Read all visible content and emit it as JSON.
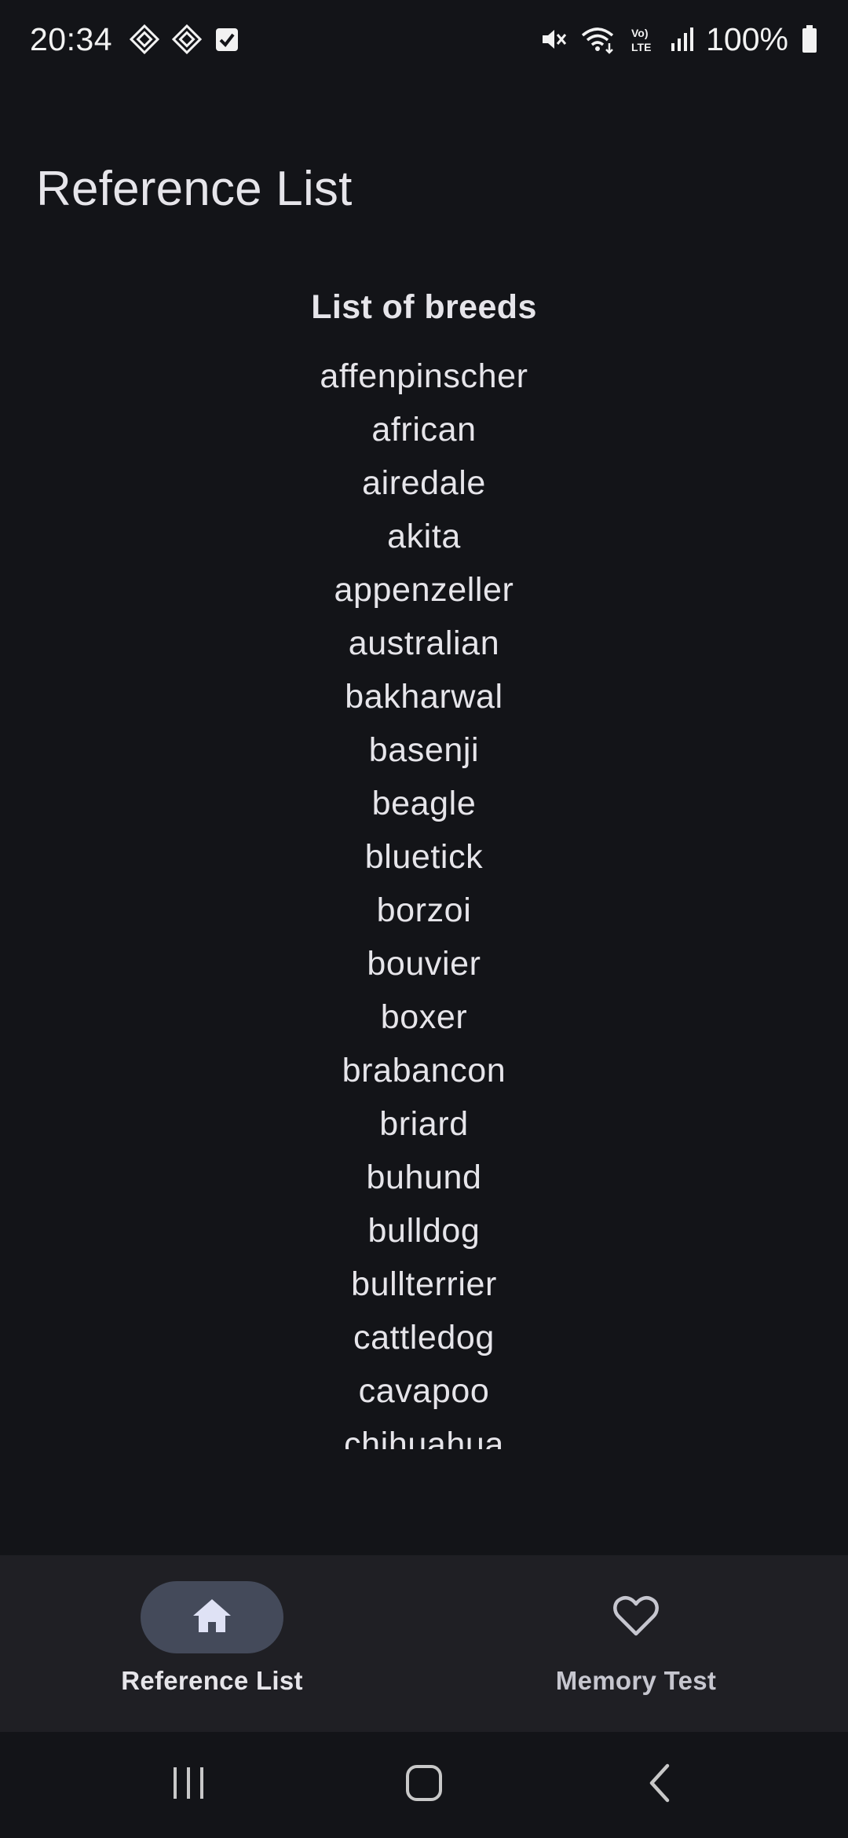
{
  "status_bar": {
    "time": "20:34",
    "battery": "100%"
  },
  "page": {
    "title": "Reference List"
  },
  "list": {
    "heading": "List of breeds",
    "items": [
      "affenpinscher",
      "african",
      "airedale",
      "akita",
      "appenzeller",
      "australian",
      "bakharwal",
      "basenji",
      "beagle",
      "bluetick",
      "borzoi",
      "bouvier",
      "boxer",
      "brabancon",
      "briard",
      "buhund",
      "bulldog",
      "bullterrier",
      "cattledog",
      "cavapoo",
      "chihuahua"
    ]
  },
  "bottom_nav": {
    "items": [
      {
        "label": "Reference List",
        "icon": "home-icon",
        "active": true
      },
      {
        "label": "Memory Test",
        "icon": "heart-icon",
        "active": false
      }
    ]
  },
  "colors": {
    "background": "#131418",
    "nav_background": "#1f1f24",
    "active_indicator": "#444a5a",
    "text": "#e6e5ea"
  }
}
